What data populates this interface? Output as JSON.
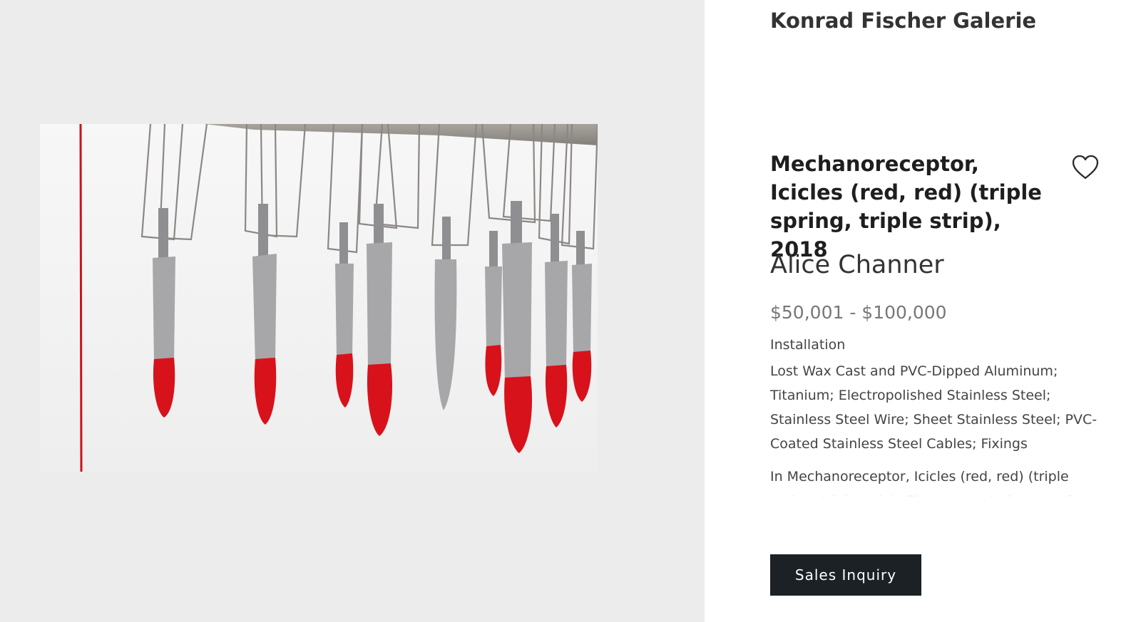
{
  "gallery": {
    "name": "Konrad Fischer Galerie"
  },
  "artwork": {
    "title": "Mechanoreceptor, Icicles (red, red) (triple spring, triple strip), 2018",
    "artist": "Alice Channer",
    "price": "$50,001 - $100,000",
    "category": "Installation",
    "materials": "Lost Wax Cast and PVC-Dipped Aluminum; Titanium; Electropolished Stainless Steel; Stainless Steel Wire; Sheet Stainless Steel; PVC-Coated Stainless Steel Cables; Fixings",
    "description": "In Mechanoreceptor, Icicles (red, red) (triple spring, triple strip), Channer cast elements f"
  },
  "actions": {
    "favorite_icon": "heart-outline-icon",
    "inquiry_label": "Sales Inquiry"
  },
  "colors": {
    "viewer_bg": "#ececec",
    "button_bg": "#1c2125",
    "accent_red": "#d8121b",
    "price_text": "#777777"
  }
}
